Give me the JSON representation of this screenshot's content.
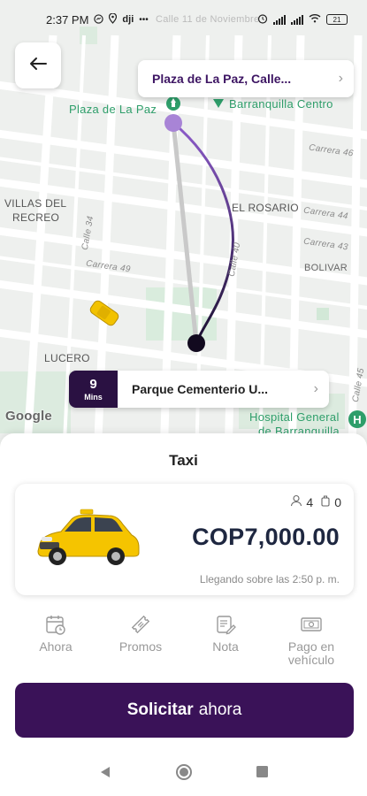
{
  "status_bar": {
    "time": "2:37 PM",
    "icons": [
      "messenger-icon",
      "location-icon",
      "dji-icon",
      "more-icon",
      "alarm-icon",
      "signal-icon",
      "signal-icon",
      "wifi-icon"
    ],
    "battery": "21"
  },
  "map": {
    "labels": {
      "plaza": "Plaza de La Paz",
      "barranquilla_centro": "Barranquilla Centro",
      "villas_line1": "VILLAS DEL",
      "villas_line2": "RECREO",
      "el_rosario": "EL ROSARIO",
      "bolivar": "BOLIVAR",
      "lucero": "LUCERO",
      "hospital_line1": "Hospital General",
      "hospital_line2": "de Barranquilla",
      "carrera_46": "Carrera 46",
      "carrera_44": "Carrera 44",
      "carrera_43": "Carrera 43",
      "carrera_49": "Carrera 49",
      "calle_34": "Calle 34",
      "calle_40": "Calle 40",
      "calle_45": "Calle 45",
      "faded": "Calle 11 de Noviembre"
    },
    "google": "Google"
  },
  "back_icon": "back-arrow-icon",
  "origin": {
    "name": "Plaza de La Paz, Calle..."
  },
  "destination": {
    "eta_value": "9",
    "eta_unit": "Mins",
    "name": "Parque Cementerio U..."
  },
  "sheet": {
    "title": "Taxi",
    "service": {
      "passengers": "4",
      "luggage": "0",
      "price": "COP7,000.00",
      "arrival": "Llegando sobre las 2:50 p. m."
    },
    "options": [
      {
        "label": "Ahora",
        "icon": "calendar-clock-icon"
      },
      {
        "label": "Promos",
        "icon": "ticket-icon"
      },
      {
        "label": "Nota",
        "icon": "note-edit-icon"
      },
      {
        "label_line1": "Pago en",
        "label_line2": "vehículo",
        "icon": "cash-icon"
      }
    ],
    "request_bold": "Solicitar",
    "request_rest": "ahora"
  },
  "colors": {
    "brand_purple": "#3a1258",
    "route_start": "#8e5ccc",
    "route_end": "#1a1030",
    "map_green": "#2e9e6a",
    "price_text": "#1e2740"
  }
}
